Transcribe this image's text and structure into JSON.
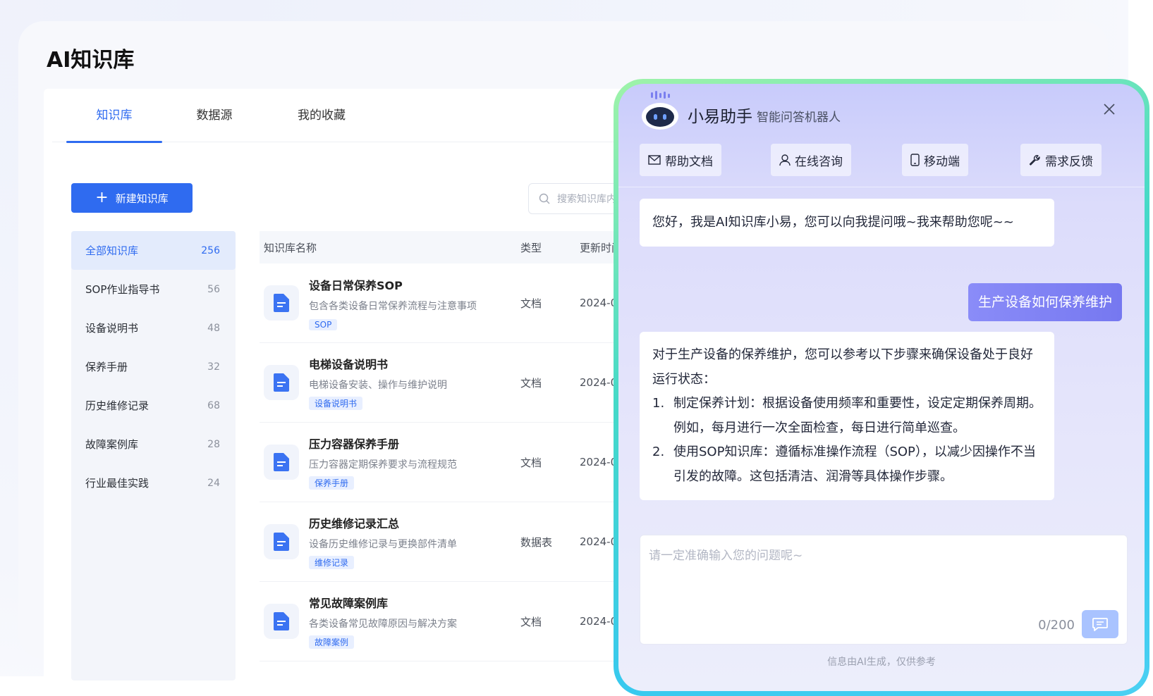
{
  "page": {
    "title": "AI知识库"
  },
  "tabs": [
    {
      "label": "知识库",
      "active": true
    },
    {
      "label": "数据源",
      "active": false
    },
    {
      "label": "我的收藏",
      "active": false
    }
  ],
  "toolbar": {
    "new_label": "新建知识库",
    "search_placeholder": "搜索知识库内容"
  },
  "categories": [
    {
      "label": "全部知识库",
      "count": "256",
      "active": true
    },
    {
      "label": "SOP作业指导书",
      "count": "56"
    },
    {
      "label": "设备说明书",
      "count": "48"
    },
    {
      "label": "保养手册",
      "count": "32"
    },
    {
      "label": "历史维修记录",
      "count": "68"
    },
    {
      "label": "故障案例库",
      "count": "28"
    },
    {
      "label": "行业最佳实践",
      "count": "24"
    }
  ],
  "table": {
    "headers": {
      "name": "知识库名称",
      "type": "类型",
      "updated": "更新时间"
    },
    "rows": [
      {
        "name": "设备日常保养SOP",
        "desc": "包含各类设备日常保养流程与注意事项",
        "tag": "SOP",
        "type": "文档",
        "date": "2024-05"
      },
      {
        "name": "电梯设备说明书",
        "desc": "电梯设备安装、操作与维护说明",
        "tag": "设备说明书",
        "type": "文档",
        "date": "2024-05"
      },
      {
        "name": "压力容器保养手册",
        "desc": "压力容器定期保养要求与流程规范",
        "tag": "保养手册",
        "type": "文档",
        "date": "2024-05"
      },
      {
        "name": "历史维修记录汇总",
        "desc": "设备历史维修记录与更换部件清单",
        "tag": "维修记录",
        "type": "数据表",
        "date": "2024-05"
      },
      {
        "name": "常见故障案例库",
        "desc": "各类设备常见故障原因与解决方案",
        "tag": "故障案例",
        "type": "文档",
        "date": "2024-05"
      }
    ]
  },
  "assistant": {
    "name": "小易助手",
    "subtitle": "智能问答机器人",
    "quick_actions": [
      {
        "label": "帮助文档",
        "icon": "mail-icon"
      },
      {
        "label": "在线咨询",
        "icon": "user-icon"
      },
      {
        "label": "移动端",
        "icon": "phone-icon"
      },
      {
        "label": "需求反馈",
        "icon": "wrench-icon"
      }
    ],
    "greeting": "您好，我是AI知识库小易，您可以向我提问哦~我来帮助您呢~~",
    "user_question": "生产设备如何保养维护",
    "answer_intro": "对于生产设备的保养维护，您可以参考以下步骤来确保设备处于良好运行状态：",
    "answer_steps": [
      {
        "num": "1.",
        "text": "制定保养计划：根据设备使用频率和重要性，设定定期保养周期。例如，每月进行一次全面检查，每日进行简单巡查。"
      },
      {
        "num": "2.",
        "text": "使用SOP知识库：遵循标准操作流程（SOP），以减少因操作不当引发的故障。这包括清洁、润滑等具体操作步骤。"
      }
    ],
    "input_placeholder": "请一定准确输入您的问题呢~",
    "counter": "0/200",
    "disclaimer": "信息由AI生成，仅供参考"
  },
  "colors": {
    "primary": "#2f6bf0",
    "user_bubble": "#7f81f4",
    "frame": "#45d9c8"
  }
}
